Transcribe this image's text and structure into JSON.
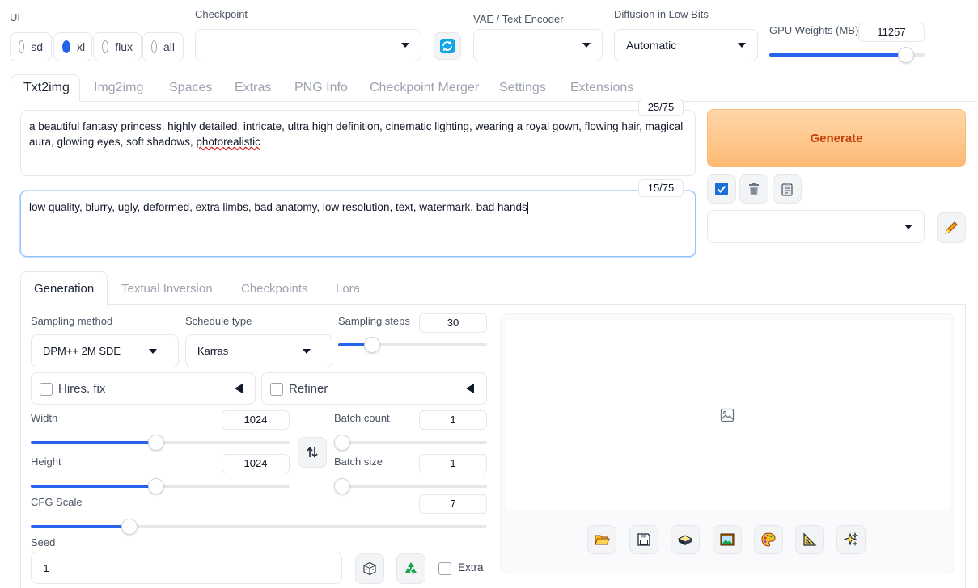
{
  "top": {
    "ui_label": "UI",
    "ui_options": [
      {
        "label": "sd",
        "selected": false
      },
      {
        "label": "xl",
        "selected": true
      },
      {
        "label": "flux",
        "selected": false
      },
      {
        "label": "all",
        "selected": false
      }
    ],
    "checkpoint_label": "Checkpoint",
    "checkpoint_value": "",
    "vae_label": "VAE / Text Encoder",
    "vae_value": "",
    "diffusion_label": "Diffusion in Low Bits",
    "diffusion_value": "Automatic",
    "gpu_label": "GPU Weights (MB)",
    "gpu_value": "11257",
    "gpu_fraction": 0.87
  },
  "tabs": [
    "Txt2img",
    "Img2img",
    "Spaces",
    "Extras",
    "PNG Info",
    "Checkpoint Merger",
    "Settings",
    "Extensions"
  ],
  "prompt": {
    "positive_text_a": "a beautiful fantasy princess, highly detailed, intricate, ultra high definition, cinematic lighting, wearing a royal gown, flowing hair, magical aura, glowing eyes, soft shadows, ",
    "positive_text_b": "photorealistic",
    "positive_counter": "25/75",
    "negative_text": "low quality, blurry, ugly, deformed, extra limbs, bad anatomy, low resolution, text, watermark, bad hands",
    "negative_counter": "15/75"
  },
  "generate_label": "Generate",
  "subtabs": [
    "Generation",
    "Textual Inversion",
    "Checkpoints",
    "Lora"
  ],
  "gen": {
    "sampling_method_label": "Sampling method",
    "sampling_method_value": "DPM++ 2M SDE",
    "schedule_type_label": "Schedule type",
    "schedule_type_value": "Karras",
    "sampling_steps_label": "Sampling steps",
    "sampling_steps_value": "30",
    "hires_label": "Hires. fix",
    "refiner_label": "Refiner",
    "width_label": "Width",
    "width_value": "1024",
    "height_label": "Height",
    "height_value": "1024",
    "batch_count_label": "Batch count",
    "batch_count_value": "1",
    "batch_size_label": "Batch size",
    "batch_size_value": "1",
    "cfg_label": "CFG Scale",
    "cfg_value": "7",
    "seed_label": "Seed",
    "seed_value": "-1",
    "extra_label": "Extra"
  },
  "colors": {
    "accent": "#2563eb",
    "generate_bg": "#fdba74",
    "generate_text": "#c2410c"
  }
}
